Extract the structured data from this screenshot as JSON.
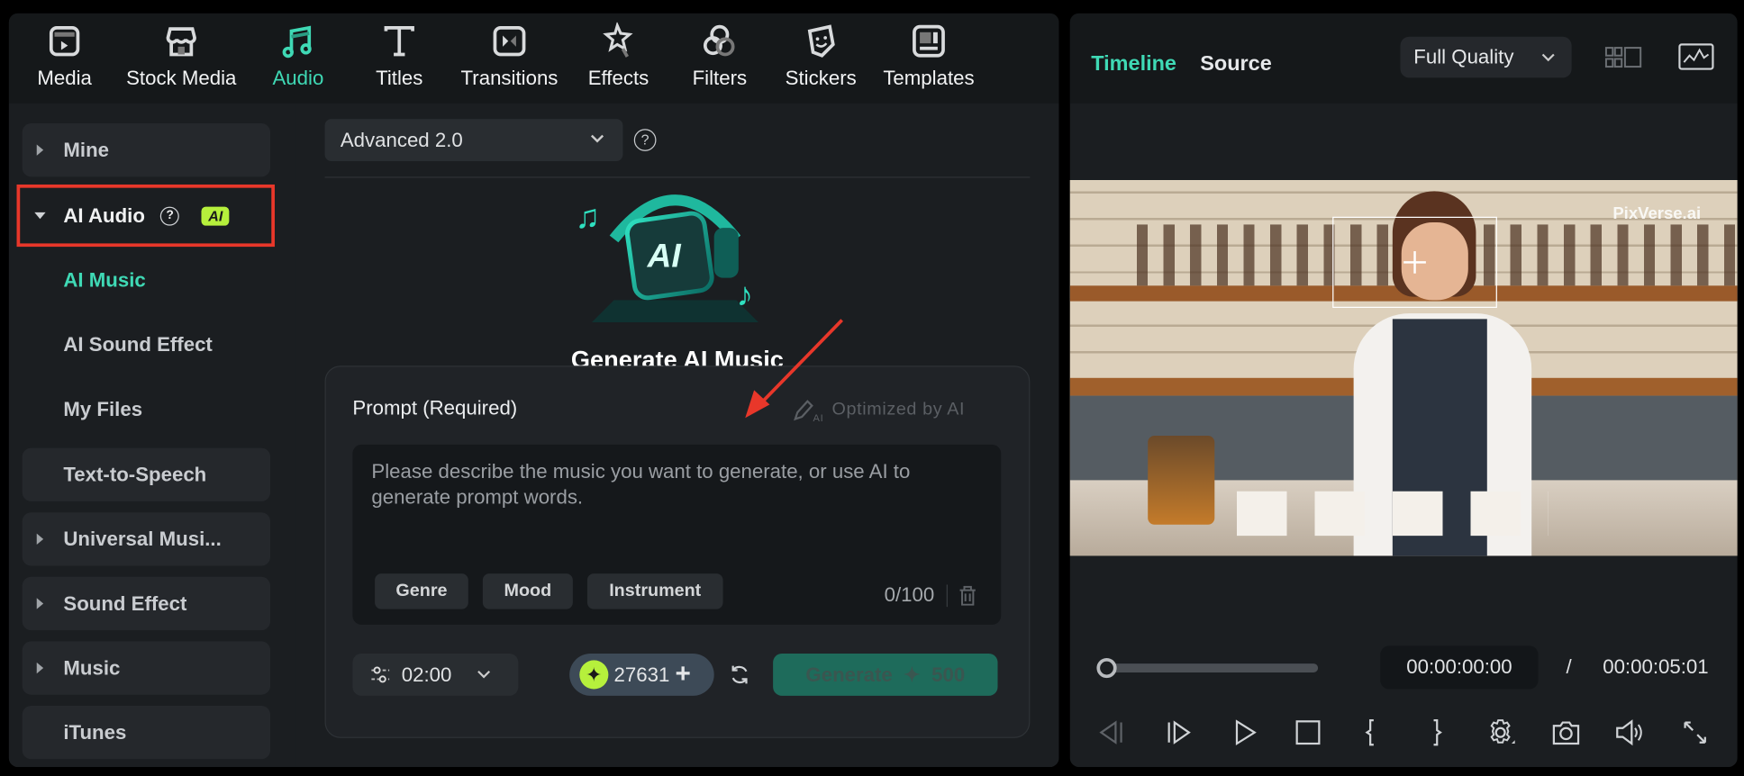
{
  "toolbar": {
    "tabs": [
      {
        "label": "Media",
        "icon": "media-icon"
      },
      {
        "label": "Stock Media",
        "icon": "store-icon"
      },
      {
        "label": "Audio",
        "icon": "music-note-icon",
        "active": true
      },
      {
        "label": "Titles",
        "icon": "text-icon"
      },
      {
        "label": "Transitions",
        "icon": "transition-icon"
      },
      {
        "label": "Effects",
        "icon": "star-wand-icon"
      },
      {
        "label": "Filters",
        "icon": "filters-icon"
      },
      {
        "label": "Stickers",
        "icon": "sticker-icon"
      },
      {
        "label": "Templates",
        "icon": "template-icon"
      }
    ]
  },
  "sidebar": {
    "items": [
      {
        "label": "Mine"
      },
      {
        "label": "AI Audio",
        "badge": "AI"
      },
      {
        "label": "AI Music"
      },
      {
        "label": "AI Sound Effect"
      },
      {
        "label": "My Files"
      },
      {
        "label": "Text-to-Speech"
      },
      {
        "label": "Universal Musi..."
      },
      {
        "label": "Sound Effect"
      },
      {
        "label": "Music"
      },
      {
        "label": "iTunes"
      }
    ]
  },
  "main": {
    "model_select": "Advanced 2.0",
    "title": "Generate AI Music",
    "prompt_label": "Prompt (Required)",
    "optimize_label": "Optimized by AI",
    "prompt_placeholder": "Please describe the music you want to generate, or use AI to generate prompt words.",
    "chips": [
      "Genre",
      "Mood",
      "Instrument"
    ],
    "char_count": "0/100",
    "duration": "02:00",
    "credits": "27631",
    "generate_label": "Generate",
    "generate_cost": "500"
  },
  "preview": {
    "tabs": [
      "Timeline",
      "Source"
    ],
    "quality": "Full Quality",
    "watermark": "PixVerse.ai",
    "current_time": "00:00:00:00",
    "separator": "/",
    "total_time": "00:00:05:01",
    "progress": 0
  },
  "colors": {
    "accent": "#3fd9b5",
    "highlight": "#e8372a",
    "generate_bg": "#1e6b5b",
    "ai_badge": "#b6f03c"
  }
}
